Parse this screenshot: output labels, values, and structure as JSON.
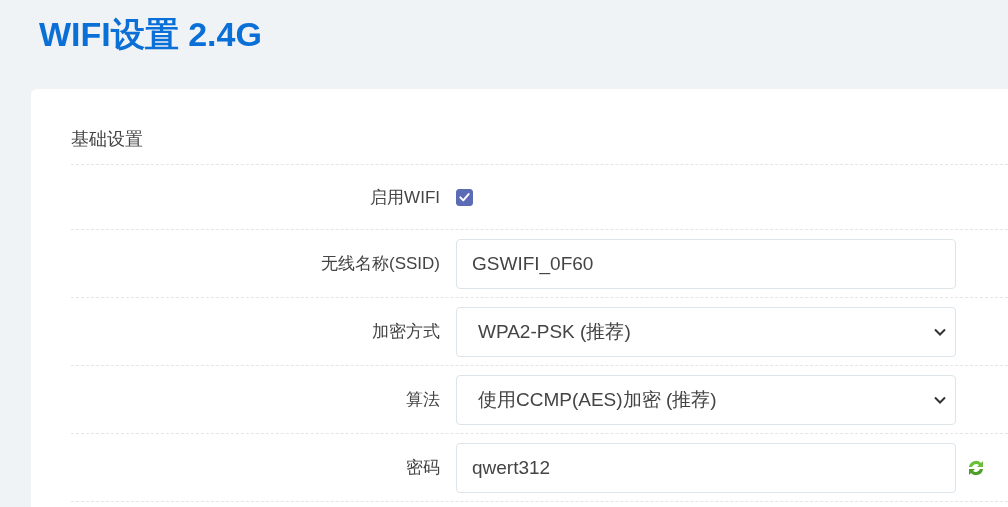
{
  "page_title": "WIFI设置 2.4G",
  "section": {
    "title": "基础设置"
  },
  "fields": [
    {
      "kind": "checkbox",
      "label": "启用WIFI",
      "checked": true
    },
    {
      "kind": "text",
      "label": "无线名称(SSID)",
      "value": "GSWIFI_0F60"
    },
    {
      "kind": "select",
      "label": "加密方式",
      "value": "WPA2-PSK (推荐)"
    },
    {
      "kind": "select",
      "label": "算法",
      "value": "使用CCMP(AES)加密 (推荐)"
    },
    {
      "kind": "password",
      "label": "密码",
      "value": "qwert312"
    }
  ]
}
